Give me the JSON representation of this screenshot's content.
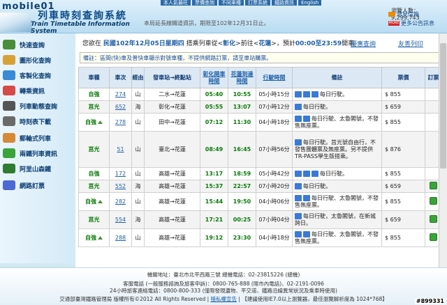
{
  "header": {
    "site_logo": "mobile01",
    "title_cn": "列車時刻查詢系統",
    "title_en": "Train Timetable Information System",
    "top_nav": [
      "本人氣最旺",
      "票價查詢",
      "不同車種",
      "訂票系統",
      "鐵路資訊",
      "English"
    ],
    "date_text": "本局延長線鐵道資訊，期限至102年12月31日止。",
    "visitor": "瀏覽人數：9,299,743",
    "rss_label": "意見信箱",
    "more_badge": "MORE",
    "more_label": "更多公告訊息"
  },
  "sidebar": {
    "items": [
      {
        "label": "快速查詢",
        "icon": "train-icon",
        "color": "#4a8d3a"
      },
      {
        "label": "圖形化查詢",
        "icon": "graph-icon",
        "color": "#d6a238"
      },
      {
        "label": "客製化查詢",
        "icon": "pencil-icon",
        "color": "#3a8ad6"
      },
      {
        "label": "轉乘資訊",
        "icon": "transfer-icon",
        "color": "#d64a4a"
      },
      {
        "label": "列車動態查詢",
        "icon": "monitor-icon",
        "color": "#555555"
      },
      {
        "label": "時刻表下載",
        "icon": "download-icon",
        "color": "#6a6a6a"
      },
      {
        "label": "郵輪式列車",
        "icon": "cruise-train-icon",
        "color": "#d68a38"
      },
      {
        "label": "兩鐵列車資訊",
        "icon": "bicycle-icon",
        "color": "#3aa43a"
      },
      {
        "label": "阿里山森鐵",
        "icon": "mountain-icon",
        "color": "#2e7d32"
      },
      {
        "label": "網路訂票",
        "icon": "ticket-icon",
        "color": "#4a6ad6"
      }
    ]
  },
  "query": {
    "prefix": "您欲在",
    "date": "民國102年12月05日星期四",
    "mid1": "搭乘列車從<",
    "from": "彰化",
    "mid2": ">前往<",
    "to": "花蓮",
    "mid3": ">，預計",
    "time_range": "00:00至23:59",
    "suffix": "開車",
    "link_preferential": "優惠查詢",
    "link_friendly": "友善列印"
  },
  "remark": "備註：區間(快)車及普快車顯示對號車種，不提供網路訂票，請至車站購票。",
  "table": {
    "headers": {
      "type": "車種",
      "train_no": "車次",
      "via": "經由",
      "route": "發車站→終點站",
      "dep": "彰化開車時間",
      "arr": "花蓮到達時間",
      "duration": "行駛時間",
      "note": "備註",
      "price": "票價",
      "book": "訂票"
    },
    "rows": [
      {
        "type": "自強",
        "mountain": false,
        "no": "274",
        "via": "山",
        "route": "二水→花蓮",
        "dep": "05:40",
        "arr": "10:55",
        "dur": "05小時15分",
        "note": "每日行駛。",
        "icons": [
          "#3a7ad6",
          "#3a7ad6",
          "#3a7ad6"
        ],
        "price": "$ 855",
        "book": false
      },
      {
        "type": "莒光",
        "mountain": false,
        "no": "652",
        "via": "海",
        "route": "彰化→花蓮",
        "dep": "05:55",
        "arr": "13:07",
        "dur": "07小時12分",
        "note": "每日行駛。",
        "icons": [
          "#3a7ad6"
        ],
        "price": "$ 659",
        "book": false
      },
      {
        "type": "自強",
        "mountain": true,
        "no": "278",
        "via": "山",
        "route": "田中→花蓮",
        "dep": "07:12",
        "arr": "11:30",
        "dur": "04小時18分",
        "note": "每日行駛、太魯閣號，不發售無座票。",
        "icons": [
          "#3a7ad6",
          "#3a7ad6"
        ],
        "price": "$ 855",
        "book": false
      },
      {
        "type": "莒光",
        "mountain": false,
        "no": "51",
        "via": "山",
        "route": "臺北→花蓮",
        "dep": "08:49",
        "arr": "16:45",
        "dur": "07小時56分",
        "note": "每日行駛。莒光號自由行，不發售團體票及無座票。另不提供TR-PASS學生版搭乘。",
        "icons": [
          "#3a7ad6"
        ],
        "price": "$ 876",
        "book": false
      },
      {
        "type": "自強",
        "mountain": false,
        "no": "172",
        "via": "山",
        "route": "高雄→花蓮",
        "dep": "13:17",
        "arr": "18:59",
        "dur": "05小時42分",
        "note": "每日行駛。",
        "icons": [
          "#3a7ad6",
          "#3a7ad6",
          "#3a7ad6"
        ],
        "price": "$ 855",
        "book": false
      },
      {
        "type": "莒光",
        "mountain": false,
        "no": "552",
        "via": "海",
        "route": "高雄→花蓮",
        "dep": "15:37",
        "arr": "22:57",
        "dur": "07小時20分",
        "note": "每日行駛。",
        "icons": [
          "#3a7ad6"
        ],
        "price": "$ 659",
        "book": true
      },
      {
        "type": "自強",
        "mountain": true,
        "no": "282",
        "via": "山",
        "route": "高雄→花蓮",
        "dep": "15:44",
        "arr": "19:50",
        "dur": "04小時06分",
        "note": "每日行駛、太魯閣號，不發售無座票。",
        "icons": [
          "#3a7ad6",
          "#3a7ad6"
        ],
        "price": "$ 855",
        "book": true
      },
      {
        "type": "莒光",
        "mountain": false,
        "no": "554",
        "via": "海",
        "route": "高雄→花蓮",
        "dep": "17:21",
        "arr": "00:25",
        "dur": "07小時04分",
        "note": "每日行駛，太魯閣號，在新城跨日。",
        "icons": [
          "#3a7ad6"
        ],
        "price": "$ 659",
        "book": true
      },
      {
        "type": "自強",
        "mountain": true,
        "no": "288",
        "via": "山",
        "route": "高雄→花蓮",
        "dep": "19:12",
        "arr": "23:30",
        "dur": "04小時18分",
        "note": "每日行駛、太魯閣號，不發售無座票。",
        "icons": [
          "#3a7ad6",
          "#3a7ad6"
        ],
        "price": "$ 855",
        "book": true
      }
    ]
  },
  "footer": {
    "line1": "機關地址：臺北市北平西路三號 總機電話：02-23815226 (總機)",
    "line2": "客服電話 (一般服務諮詢及旅客申訴)：0800-765-888 (限市內電話)、02-2191-0096",
    "line3": "24小時旅客連絡電話：0800-800-333 (僅限發現遺物、平交道、鐵路沿線異常狀況及乘車時使用)",
    "line4_a": "交通部臺灣鐵路管理局 版權所有©2012 All Rights Reserved |",
    "line4_link": "隱私權宣告",
    "line4_b": "| 【建議使用IE7.0以上瀏覽器，最佳瀏覽解析度為 1024*768】",
    "watermark": "#899331"
  }
}
